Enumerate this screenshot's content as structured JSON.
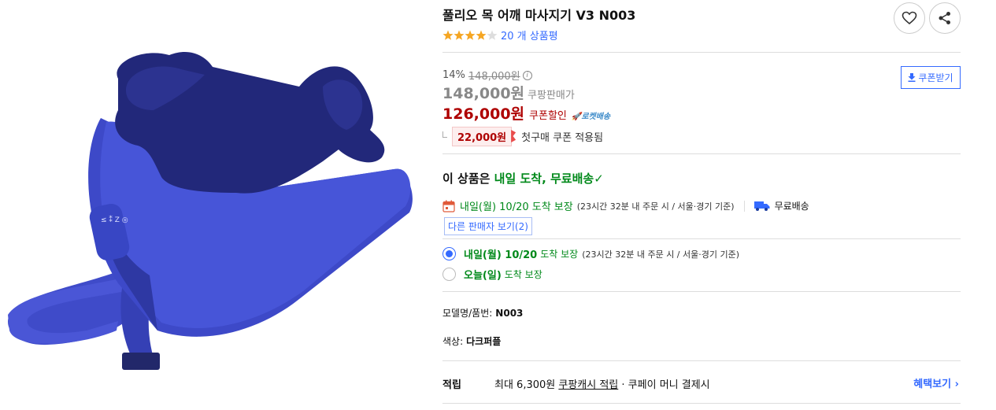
{
  "product": {
    "title": "풀리오 목 어깨 마사지기 V3 N003",
    "rating": 4.5,
    "review_count": "20 개 상품평"
  },
  "price": {
    "discount_rate": "14%",
    "original_price": "148,000원",
    "base_price": "148,000원",
    "base_label": "쿠팡판매가",
    "sale_price": "126,000원",
    "sale_label": "쿠폰할인",
    "rocket_label": "로켓배송",
    "coupon_amount": "22,000원",
    "coupon_desc": "첫구매 쿠폰 적용됨",
    "coupon_button": "쿠폰받기"
  },
  "arrival": {
    "prefix": "이 상품은 ",
    "highlight": "내일 도착, 무료배송",
    "check": "✓"
  },
  "delivery": {
    "date": "내일(월) 10/20 도착 보장",
    "note": "(23시간 32분 내 주문 시 / 서울·경기 기준)",
    "free_shipping": "무료배송",
    "other_sellers": "다른 판매자 보기(2)"
  },
  "options": [
    {
      "bold": "내일(월) 10/20",
      "light": "도착 보장",
      "note": "(23시간 32분 내 주문 시 / 서울·경기 기준)",
      "checked": true
    },
    {
      "bold": "오늘(일)",
      "light": "도착 보장",
      "note": "",
      "checked": false
    }
  ],
  "specs": {
    "model_label": "모델명/품번:",
    "model_value": "N003",
    "color_label": "색상:",
    "color_value": "다크퍼플"
  },
  "reward": {
    "label": "적립",
    "prefix": "최대 6,300원 ",
    "link": "쿠팡캐시 적립",
    "suffix": " · 쿠페이 머니 결제시",
    "benefit": "혜택보기"
  },
  "icons": [
    "heart-icon",
    "share-icon",
    "info-icon",
    "download-icon",
    "rocket-icon",
    "calendar-icon",
    "truck-icon",
    "check-icon",
    "chevron-right-icon"
  ],
  "colors": {
    "accent": "#346aff",
    "sale": "#ae0000",
    "green": "#00891a",
    "star": "#f5a623",
    "product": "#3a44b8"
  }
}
